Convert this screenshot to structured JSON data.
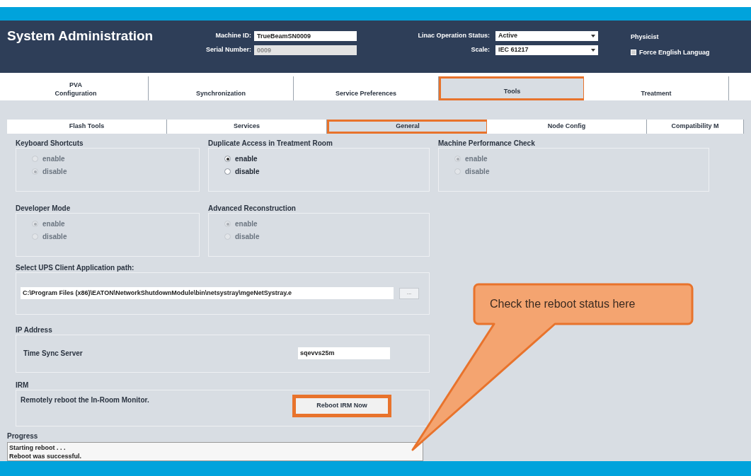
{
  "header": {
    "title": "System Administration",
    "machine_id": {
      "label": "Machine ID:",
      "value": "TrueBeamSN0009"
    },
    "serial_number": {
      "label": "Serial Number:",
      "value": "0009",
      "disabled": true
    },
    "linac_status": {
      "label": "Linac Operation Status:",
      "value": "Active"
    },
    "scale": {
      "label": "Scale:",
      "value": "IEC 61217"
    },
    "role": "Physicist",
    "force_english": {
      "label": "Force English Languag",
      "checked": true
    }
  },
  "tabs": [
    {
      "lines": [
        "PVA",
        "Configuration"
      ],
      "selected": false,
      "highlighted": false
    },
    {
      "lines": [
        "Synchronization"
      ],
      "selected": false,
      "highlighted": false
    },
    {
      "lines": [
        "Service Preferences"
      ],
      "selected": false,
      "highlighted": false
    },
    {
      "lines": [
        "Tools"
      ],
      "selected": true,
      "highlighted": true
    },
    {
      "lines": [
        "Treatment"
      ],
      "selected": false,
      "highlighted": false
    }
  ],
  "subtabs": [
    {
      "label": "Flash Tools",
      "selected": false,
      "highlighted": false
    },
    {
      "label": "Services",
      "selected": false,
      "highlighted": false
    },
    {
      "label": "General",
      "selected": true,
      "highlighted": true
    },
    {
      "label": "Node Config",
      "selected": false,
      "highlighted": false
    },
    {
      "label": "Compatibility M",
      "selected": false,
      "highlighted": false
    }
  ],
  "option_groups": [
    {
      "title": "Keyboard Shortcuts",
      "disabled": true,
      "options": [
        {
          "label": "enable",
          "selected": false
        },
        {
          "label": "disable",
          "selected": true
        }
      ]
    },
    {
      "title": "Duplicate Access in Treatment Room",
      "disabled": false,
      "options": [
        {
          "label": "enable",
          "selected": true
        },
        {
          "label": "disable",
          "selected": false
        }
      ]
    },
    {
      "title": "Machine Performance Check",
      "disabled": true,
      "options": [
        {
          "label": "enable",
          "selected": true
        },
        {
          "label": "disable",
          "selected": false
        }
      ]
    },
    {
      "title": "Developer Mode",
      "disabled": true,
      "options": [
        {
          "label": "enable",
          "selected": true
        },
        {
          "label": "disable",
          "selected": false
        }
      ]
    },
    {
      "title": "Advanced Reconstruction",
      "disabled": true,
      "options": [
        {
          "label": "enable",
          "selected": true
        },
        {
          "label": "disable",
          "selected": false
        }
      ]
    }
  ],
  "ups": {
    "title": "Select UPS Client Application path:",
    "value": "C:\\Program Files (x86)\\EATON\\NetworkShutdownModule\\bin\\netsystray\\mgeNetSystray.e",
    "browse": "..."
  },
  "ip": {
    "title": "IP Address",
    "label": "Time Sync Server",
    "value": "sqevvs25m"
  },
  "irm": {
    "title": "IRM",
    "text": "Remotely reboot the In-Room Monitor.",
    "button": "Reboot IRM Now",
    "highlighted": true
  },
  "progress": {
    "title": "Progress",
    "lines": [
      "Starting reboot . . .",
      "Reboot was successful."
    ]
  },
  "callout": {
    "text": "Check the reboot status here"
  }
}
